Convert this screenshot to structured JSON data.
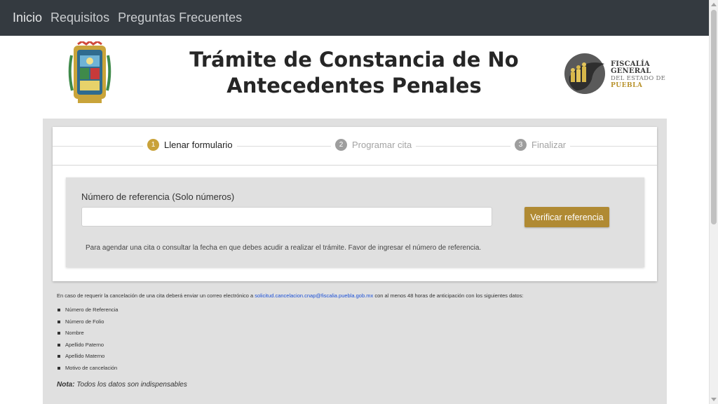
{
  "nav": {
    "items": [
      {
        "label": "Inicio"
      },
      {
        "label": "Requisitos"
      },
      {
        "label": "Preguntas Frecuentes"
      }
    ]
  },
  "header": {
    "title_line1": "Trámite de Constancia de No",
    "title_line2": "Antecedentes Penales",
    "logo_right": {
      "line1": "FISCALÍA GENERAL",
      "line2": "DEL ESTADO DE",
      "line3": "PUEBLA"
    }
  },
  "stepper": {
    "steps": [
      {
        "number": "1",
        "label": "Llenar formulario",
        "active": true
      },
      {
        "number": "2",
        "label": "Programar cita",
        "active": false
      },
      {
        "number": "3",
        "label": "Finalizar",
        "active": false
      }
    ]
  },
  "form": {
    "field_label": "Número de referencia (Solo números)",
    "input_value": "",
    "input_placeholder": "",
    "verify_button": "Verificar referencia",
    "help_text": "Para agendar una cita o consultar la fecha en que debes acudir a realizar el trámite. Favor de ingresar el número de referencia."
  },
  "cancellation": {
    "text_before": "En caso de requerir la cancelación de una cita deberá enviar un correo electrónico a",
    "email": "solicitud.cancelacion.cnap@fiscalia.puebla.gob.mx",
    "text_after": "con al menos 48 horas de anticipación con los siguientes datos:",
    "items": [
      "Número de Referencia",
      "Número de Folio",
      "Nombre",
      "Apellido Paterno",
      "Apellido Materno",
      "Motivo de cancelación"
    ],
    "note_label": "Nota:",
    "note_text": "Todos los datos son indispensables"
  },
  "colors": {
    "navbar": "#343a40",
    "accent_gold": "#b08a33",
    "step_active": "#c9a23a",
    "step_inactive": "#9e9e9e",
    "link": "#1a4fd6"
  }
}
